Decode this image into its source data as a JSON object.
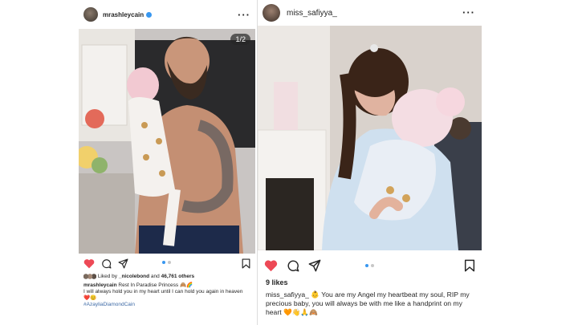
{
  "left_post": {
    "username": "mrashleycain",
    "image_counter": "1/2",
    "liked_by_prefix": "Liked by ",
    "liked_by_user": "_nicolebond",
    "liked_by_and": " and ",
    "likes_count": "46,761 others",
    "caption_user": "mrashleycain",
    "caption_title": "Rest In Paradise Princess 🙈🌈",
    "caption_body": "I will always hold you in my heart until I can hold you again in heaven ❤️😊",
    "hashtag": "#AzayliaDiamondCain"
  },
  "right_post": {
    "username": "miss_safiyya_",
    "likes": "9 likes",
    "caption_user": "miss_safiyya_",
    "caption_body": "👶 You are my Angel my heartbeat my soul, RIP my precious baby, you will always be with me like a handprint on my heart 🧡👋🙏🙈"
  },
  "icons": [
    "heart-icon",
    "comment-icon",
    "share-icon",
    "bookmark-icon",
    "more-icon",
    "verified-icon"
  ],
  "colors": {
    "like_red": "#ed4956",
    "link_blue": "#3897f0",
    "hashtag": "#3d6aa6"
  }
}
